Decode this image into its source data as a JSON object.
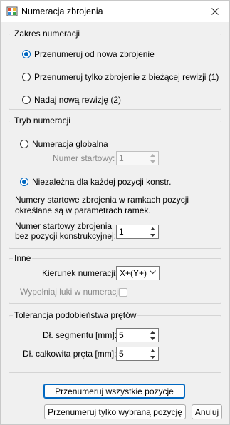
{
  "window": {
    "title": "Numeracja zbrojenia"
  },
  "group_range": {
    "legend": "Zakres numeracji",
    "opt_renumber_new": "Przenumeruj od nowa zbrojenie",
    "opt_renumber_current": "Przenumeruj tylko zbrojenie z bieżącej rewizji (1)",
    "opt_new_revision": "Nadaj nową rewizję (2)",
    "selected": "opt_renumber_new"
  },
  "group_mode": {
    "legend": "Tryb numeracji",
    "opt_global": "Numeracja globalna",
    "start_label": "Numer startowy:",
    "start_value": "1",
    "opt_independent": "Niezależna dla każdej pozycji konstr.",
    "selected": "opt_independent",
    "note": "Numery startowe zbrojenia w ramkach pozycji określane są w parametrach ramek.",
    "start_no_pos_label_line1": "Numer startowy zbrojenia",
    "start_no_pos_label_line2": "bez pozycji konstrukcyjnej:",
    "start_no_pos_value": "1"
  },
  "group_other": {
    "legend": "Inne",
    "direction_label": "Kierunek numeracji:",
    "direction_value": "X+(Y+)",
    "fill_gaps_label": "Wypełniaj luki w numeracji",
    "fill_gaps_checked": false
  },
  "group_tolerance": {
    "legend": "Tolerancja podobieństwa prętów",
    "segment_label": "Dł. segmentu [mm]:",
    "segment_value": "5",
    "total_label": "Dł. całkowita pręta [mm]:",
    "total_value": "5"
  },
  "buttons": {
    "renumber_all": "Przenumeruj wszystkie pozycje",
    "renumber_selected": "Przenumeruj tylko wybraną pozycję",
    "cancel": "Anuluj"
  },
  "colors": {
    "accent": "#0067c0",
    "window_bg": "#f0f0f0",
    "disabled_text": "#8a8a8a"
  },
  "icons": {
    "app": "rebar-numbering-icon",
    "close": "close-icon"
  }
}
